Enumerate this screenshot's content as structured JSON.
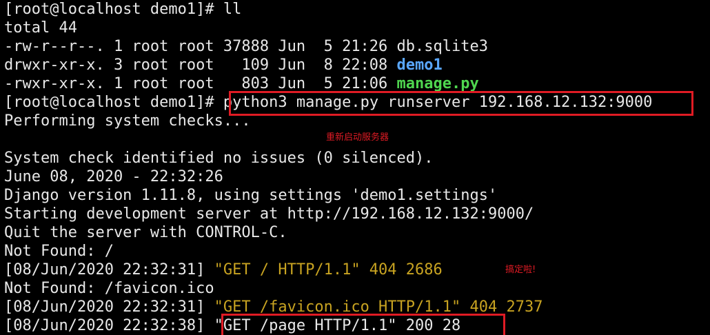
{
  "terminal": {
    "lines": {
      "l0": {
        "prompt": "[root@localhost demo1]# ",
        "cmd": "ll"
      },
      "l1": "total 44",
      "l2": {
        "meta": "-rw-r--r--. 1 root root 37888 Jun  5 21:26 ",
        "name": "db.sqlite3"
      },
      "l3": {
        "meta": "drwxr-xr-x. 3 root root   109 Jun  8 22:08 ",
        "name": "demo1"
      },
      "l4": {
        "meta": "-rwxr-xr-x. 1 root root   803 Jun  5 21:06 ",
        "name": "manage.py"
      },
      "l5": {
        "prompt": "[root@localhost demo1]# ",
        "cmd": "python3 manage.py runserver 192.168.12.132:9000"
      },
      "l6": "Performing system checks...",
      "l7": "",
      "l8": "System check identified no issues (0 silenced).",
      "l9": "June 08, 2020 - 22:32:26",
      "l10": "Django version 1.11.8, using settings 'demo1.settings'",
      "l11": "Starting development server at http://192.168.12.132:9000/",
      "l12": "Quit the server with CONTROL-C.",
      "l13": "Not Found: /",
      "l14": {
        "ts": "[08/Jun/2020 22:32:31] ",
        "req": "\"GET / HTTP/1.1\" 404 2686"
      },
      "l15": "Not Found: /favicon.ico",
      "l16": {
        "ts": "[08/Jun/2020 22:32:31] ",
        "req": "\"GET /favicon.ico HTTP/1.1\" 404 2737"
      },
      "l17": {
        "ts": "[08/Jun/2020 22:32:38] ",
        "req": "\"GET /page HTTP/1.1\" 200 28"
      }
    },
    "annotations": {
      "restart": "重新启动服务器",
      "done": "搞定啦!"
    },
    "colors": {
      "background": "#000000",
      "text": "#e8e8e8",
      "directory": "#5aa7ff",
      "executable": "#4fd64f",
      "request": "#c8a321",
      "highlight": "#e01b24"
    }
  }
}
